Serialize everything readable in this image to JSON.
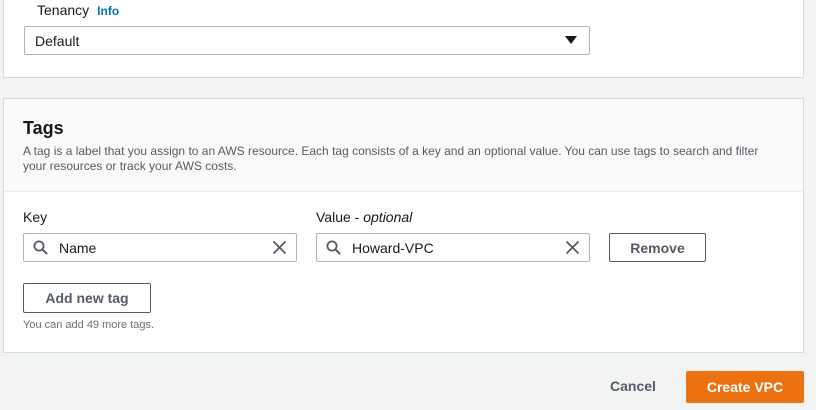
{
  "tenancy": {
    "label": "Tenancy",
    "info": "Info",
    "selected": "Default"
  },
  "tags": {
    "title": "Tags",
    "description": "A tag is a label that you assign to an AWS resource. Each tag consists of a key and an optional value. You can use tags to search and filter your resources or track your AWS costs.",
    "key_label": "Key",
    "value_label": "Value",
    "value_optional": "optional",
    "rows": [
      {
        "key": "Name",
        "value": "Howard-VPC",
        "remove_label": "Remove"
      }
    ],
    "add_label": "Add new tag",
    "hint": "You can add 49 more tags."
  },
  "footer": {
    "cancel_label": "Cancel",
    "submit_label": "Create VPC"
  },
  "colors": {
    "primary": "#ec7211",
    "link": "#0073bb",
    "border": "#aab7b8",
    "background": "#f2f3f3"
  },
  "icons": [
    "caret-down-icon",
    "search-icon",
    "clear-icon"
  ]
}
